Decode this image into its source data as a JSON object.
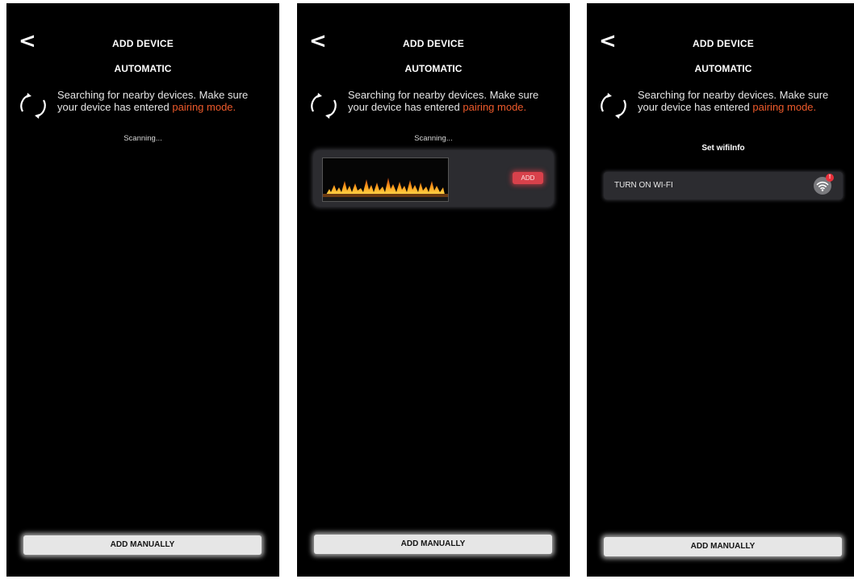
{
  "app": {
    "header": {
      "back_label": "<",
      "title": "ADD DEVICE"
    },
    "mode_tab": "AUTOMATIC",
    "search": {
      "icon": "refresh-icon",
      "message": "Searching for nearby devices. Make sure your device has entered ",
      "link": "pairing mode."
    },
    "add_manually_label": "ADD MANUALLY"
  },
  "screens": [
    {
      "status": "Scanning..."
    },
    {
      "status": "Scanning...",
      "device_card": {
        "thumbnail": "fireplace-flame-image",
        "add_label": "ADD"
      }
    },
    {
      "section_label": "Set wifiInfo",
      "wifi_row": {
        "label": "TURN ON WI-FI",
        "icon": "wifi-icon",
        "badge": "!"
      }
    }
  ],
  "colors": {
    "background": "#000000",
    "accent_link": "#ee5a2b",
    "add_button": "#d8414b",
    "card": "#2c2c30",
    "manual_button": "#e6e6e6"
  }
}
